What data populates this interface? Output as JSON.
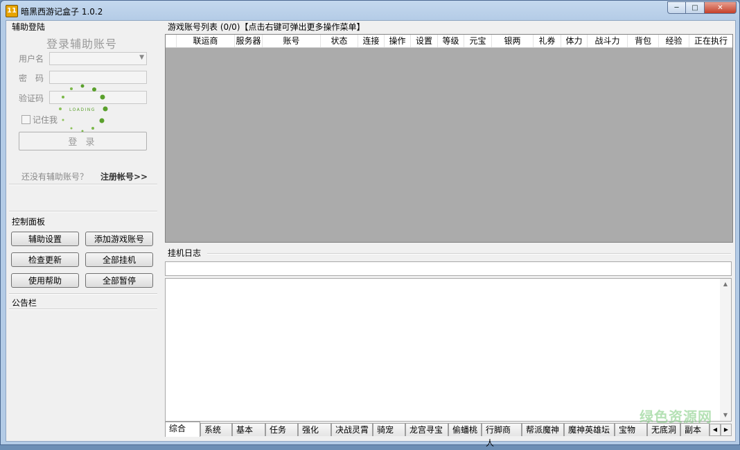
{
  "window": {
    "title": "暗黑西游记盒子 1.0.2",
    "icon_text": "11"
  },
  "login": {
    "section": "辅助登陆",
    "title": "登录辅助账号",
    "username_label": "用户名",
    "password_label": "密　码",
    "captcha_label": "验证码",
    "remember_label": "记住我",
    "login_button": "登 录",
    "loading_text": "LOADING",
    "no_account": "还没有辅助账号？",
    "register": "注册帐号>>"
  },
  "control": {
    "section": "控制面板",
    "buttons": [
      "辅助设置",
      "添加游戏账号",
      "检查更新",
      "全部挂机",
      "使用帮助",
      "全部暂停"
    ]
  },
  "notice": {
    "section": "公告栏"
  },
  "accounts": {
    "header": "游戏账号列表 (0/0)【点击右键可弹出更多操作菜单】",
    "columns": [
      "联运商",
      "服务器",
      "账号",
      "状态",
      "连接",
      "操作",
      "设置",
      "等级",
      "元宝",
      "银两",
      "礼券",
      "体力",
      "战斗力",
      "背包",
      "经验",
      "正在执行"
    ]
  },
  "log": {
    "section": "挂机日志"
  },
  "tabs": [
    "综合",
    "系统",
    "基本",
    "任务",
    "强化",
    "决战灵霄",
    "骑宠",
    "龙宫寻宝",
    "偷蟠桃",
    "行脚商人",
    "帮派魔神",
    "魔神英雄坛",
    "宝物",
    "无底洞",
    "副本"
  ],
  "active_tab": "综合",
  "watermark": "绿色资源网"
}
